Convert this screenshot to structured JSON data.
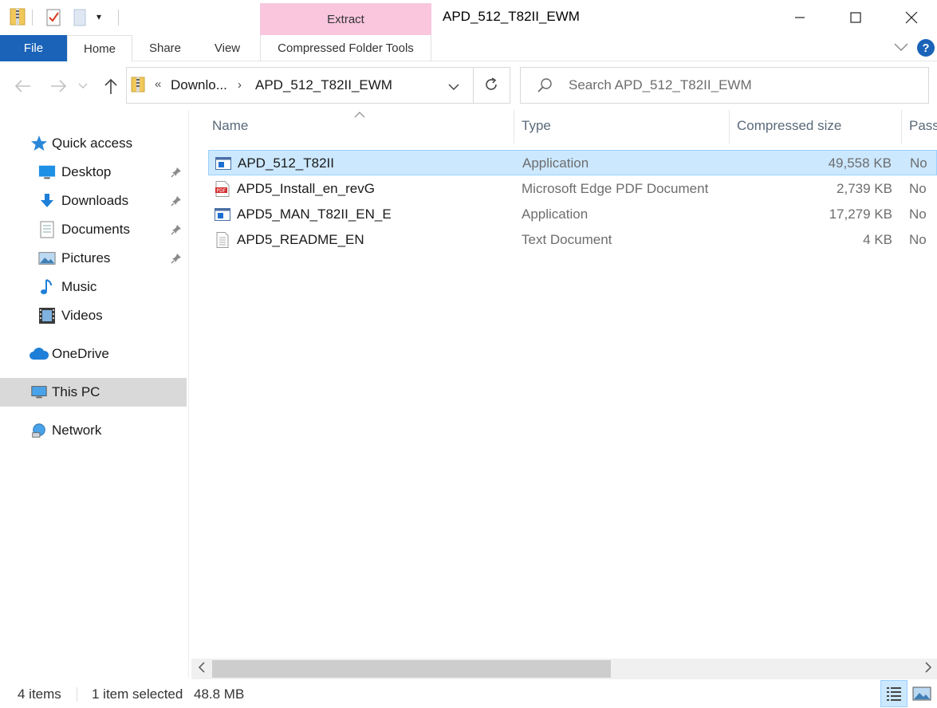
{
  "window": {
    "title": "APD_512_T82II_EWM",
    "context_tab": "Extract",
    "controls": [
      "minimize",
      "maximize",
      "close"
    ]
  },
  "ribbon": {
    "tabs": [
      "File",
      "Home",
      "Share",
      "View",
      "Compressed Folder Tools"
    ]
  },
  "address": {
    "overflow": "«",
    "crumbs": [
      "Downlo...",
      "APD_512_T82II_EWM"
    ]
  },
  "search": {
    "placeholder": "Search APD_512_T82II_EWM"
  },
  "sidebar": {
    "quick_access": "Quick access",
    "items": [
      {
        "label": "Desktop",
        "icon": "desktop-icon",
        "pinned": true
      },
      {
        "label": "Downloads",
        "icon": "downloads-icon",
        "pinned": true
      },
      {
        "label": "Documents",
        "icon": "documents-icon",
        "pinned": true
      },
      {
        "label": "Pictures",
        "icon": "pictures-icon",
        "pinned": true
      },
      {
        "label": "Music",
        "icon": "music-icon",
        "pinned": false
      },
      {
        "label": "Videos",
        "icon": "videos-icon",
        "pinned": false
      }
    ],
    "onedrive": "OneDrive",
    "thispc": "This PC",
    "network": "Network"
  },
  "columns": [
    "Name",
    "Type",
    "Compressed size",
    "Passw"
  ],
  "files": [
    {
      "name": "APD_512_T82II",
      "type": "Application",
      "size": "49,558 KB",
      "pw": "No",
      "icon": "application-icon",
      "selected": true
    },
    {
      "name": "APD5_Install_en_revG",
      "type": "Microsoft Edge PDF Document",
      "size": "2,739 KB",
      "pw": "No",
      "icon": "pdf-icon",
      "selected": false
    },
    {
      "name": "APD5_MAN_T82II_EN_E",
      "type": "Application",
      "size": "17,279 KB",
      "pw": "No",
      "icon": "application-icon",
      "selected": false
    },
    {
      "name": "APD5_README_EN",
      "type": "Text Document",
      "size": "4 KB",
      "pw": "No",
      "icon": "text-document-icon",
      "selected": false
    }
  ],
  "status": {
    "count": "4 items",
    "selection": "1 item selected",
    "size": "48.8 MB"
  },
  "colors": {
    "file_tab": "#1a63b8",
    "extract_tab": "#f9c6de",
    "selection": "#cce8ff",
    "nav_selected": "#d9d9d9"
  }
}
